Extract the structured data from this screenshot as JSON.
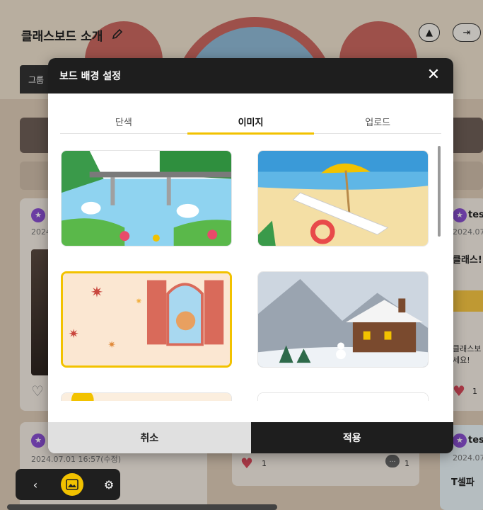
{
  "board": {
    "title": "클래스보드 소개",
    "group_tab": "그룹"
  },
  "bg_posts": {
    "left_date": "2024",
    "left_date2": "2024.07.01 16:57(수정)",
    "right_name1": "tes",
    "right_date1": "2024.07.",
    "right_title1": "클래스!",
    "right_text1": "클래스보",
    "right_text2": "세요!",
    "right_name2": "tes",
    "right_date2": "2024.07.",
    "right_title2": "T셀파 ",
    "like_count": "1",
    "mid_like": "1",
    "mid_comment": "1"
  },
  "modal": {
    "title": "보드 배경 설정",
    "tabs": [
      {
        "label": "단색",
        "active": false
      },
      {
        "label": "이미지",
        "active": true
      },
      {
        "label": "업로드",
        "active": false
      }
    ],
    "cancel_label": "취소",
    "apply_label": "적용"
  },
  "colors": {
    "accent": "#f2c200",
    "header_bg": "#1e1e1e"
  },
  "icons": {
    "edit": "pencil-icon",
    "share": "share-icon",
    "logout": "logout-icon",
    "close": "close-icon",
    "back": "chevron-left-icon",
    "background": "image-icon",
    "settings": "gear-icon"
  }
}
